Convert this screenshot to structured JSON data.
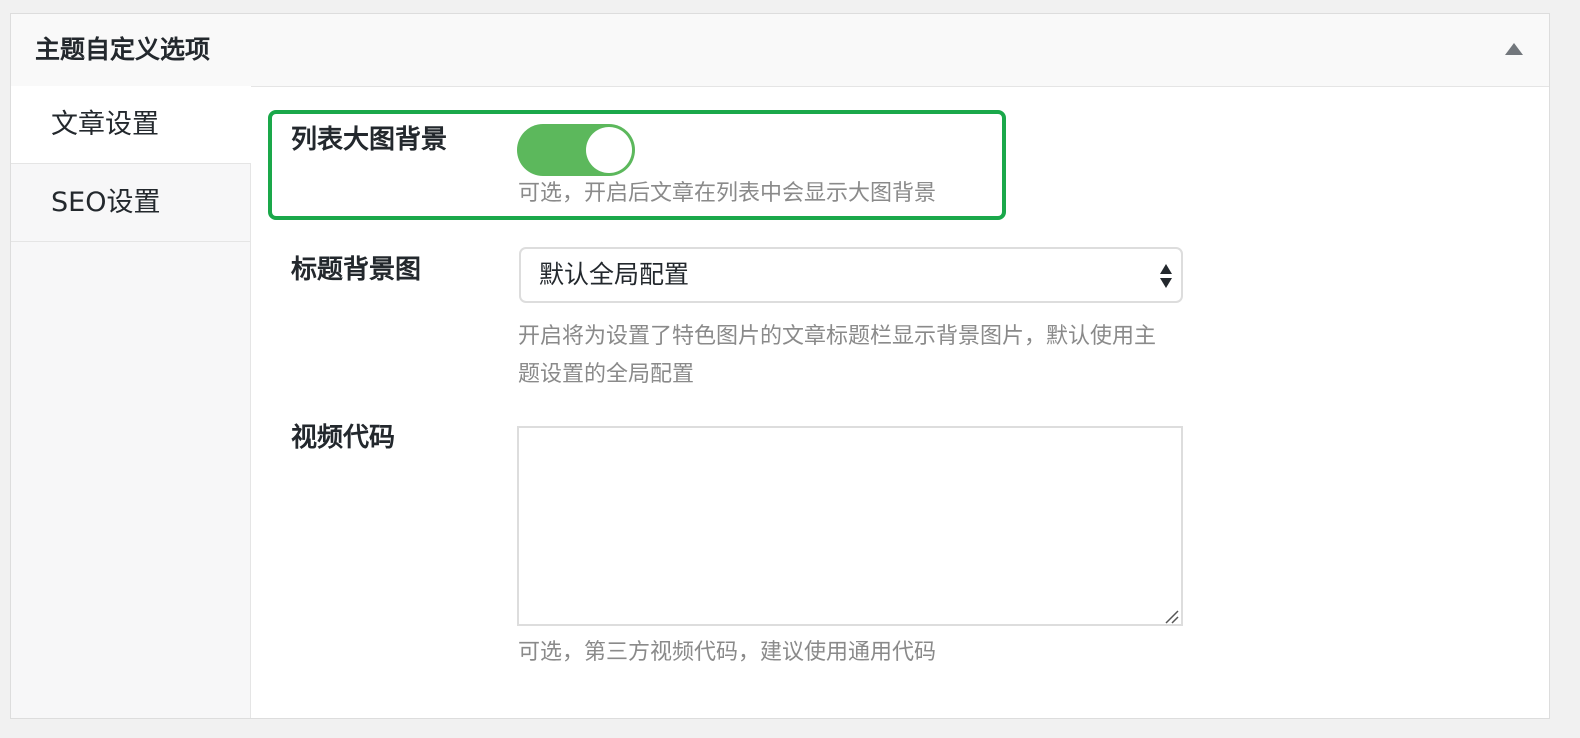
{
  "metabox": {
    "title": "主题自定义选项"
  },
  "tabs": [
    {
      "label": "文章设置",
      "active": true
    },
    {
      "label": "SEO设置",
      "active": false
    }
  ],
  "fields": {
    "list_bg": {
      "label": "列表大图背景",
      "enabled": true,
      "description": "可选，开启后文章在列表中会显示大图背景"
    },
    "title_bg": {
      "label": "标题背景图",
      "selected": "默认全局配置",
      "description": "开启将为设置了特色图片的文章标题栏显示背景图片，默认使用主题设置的全局配置"
    },
    "video": {
      "label": "视频代码",
      "value": "",
      "description": "可选，第三方视频代码，建议使用通用代码"
    }
  },
  "colors": {
    "highlight": "#1aa84a",
    "toggle_on": "#5cb85c"
  }
}
